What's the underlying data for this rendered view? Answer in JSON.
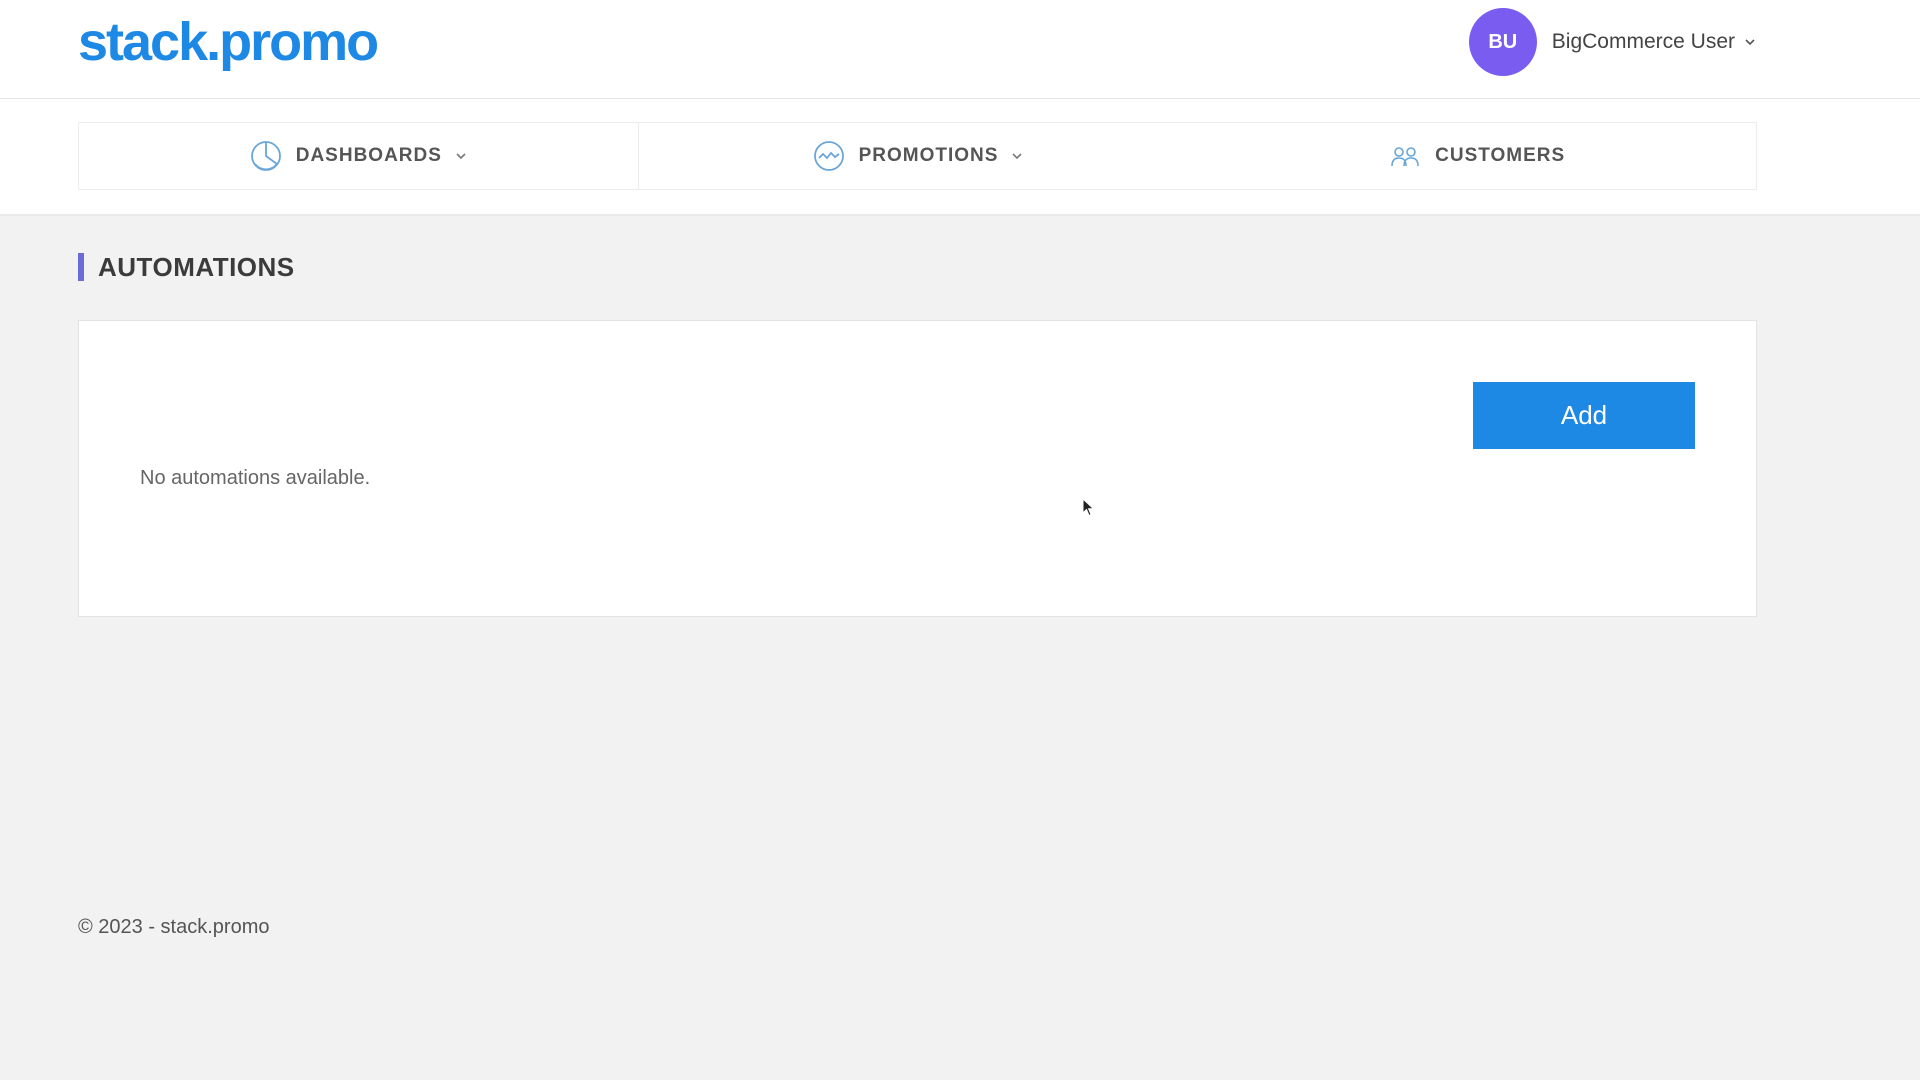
{
  "header": {
    "logo": "stack.promo",
    "user": {
      "initials": "BU",
      "name": "BigCommerce User",
      "avatar_color": "#7b5cf0"
    }
  },
  "nav": {
    "items": [
      {
        "label": "DASHBOARDS",
        "icon": "pie-chart-icon",
        "has_dropdown": true
      },
      {
        "label": "PROMOTIONS",
        "icon": "activity-icon",
        "has_dropdown": true
      },
      {
        "label": "CUSTOMERS",
        "icon": "users-icon",
        "has_dropdown": false
      }
    ]
  },
  "page": {
    "title": "AUTOMATIONS",
    "add_label": "Add",
    "empty_message": "No automations available."
  },
  "footer": {
    "text": "© 2023 - stack.promo"
  },
  "colors": {
    "accent": "#1e88e5",
    "title_bar": "#6a6bd8",
    "icon_blue": "#6aa6d8"
  }
}
